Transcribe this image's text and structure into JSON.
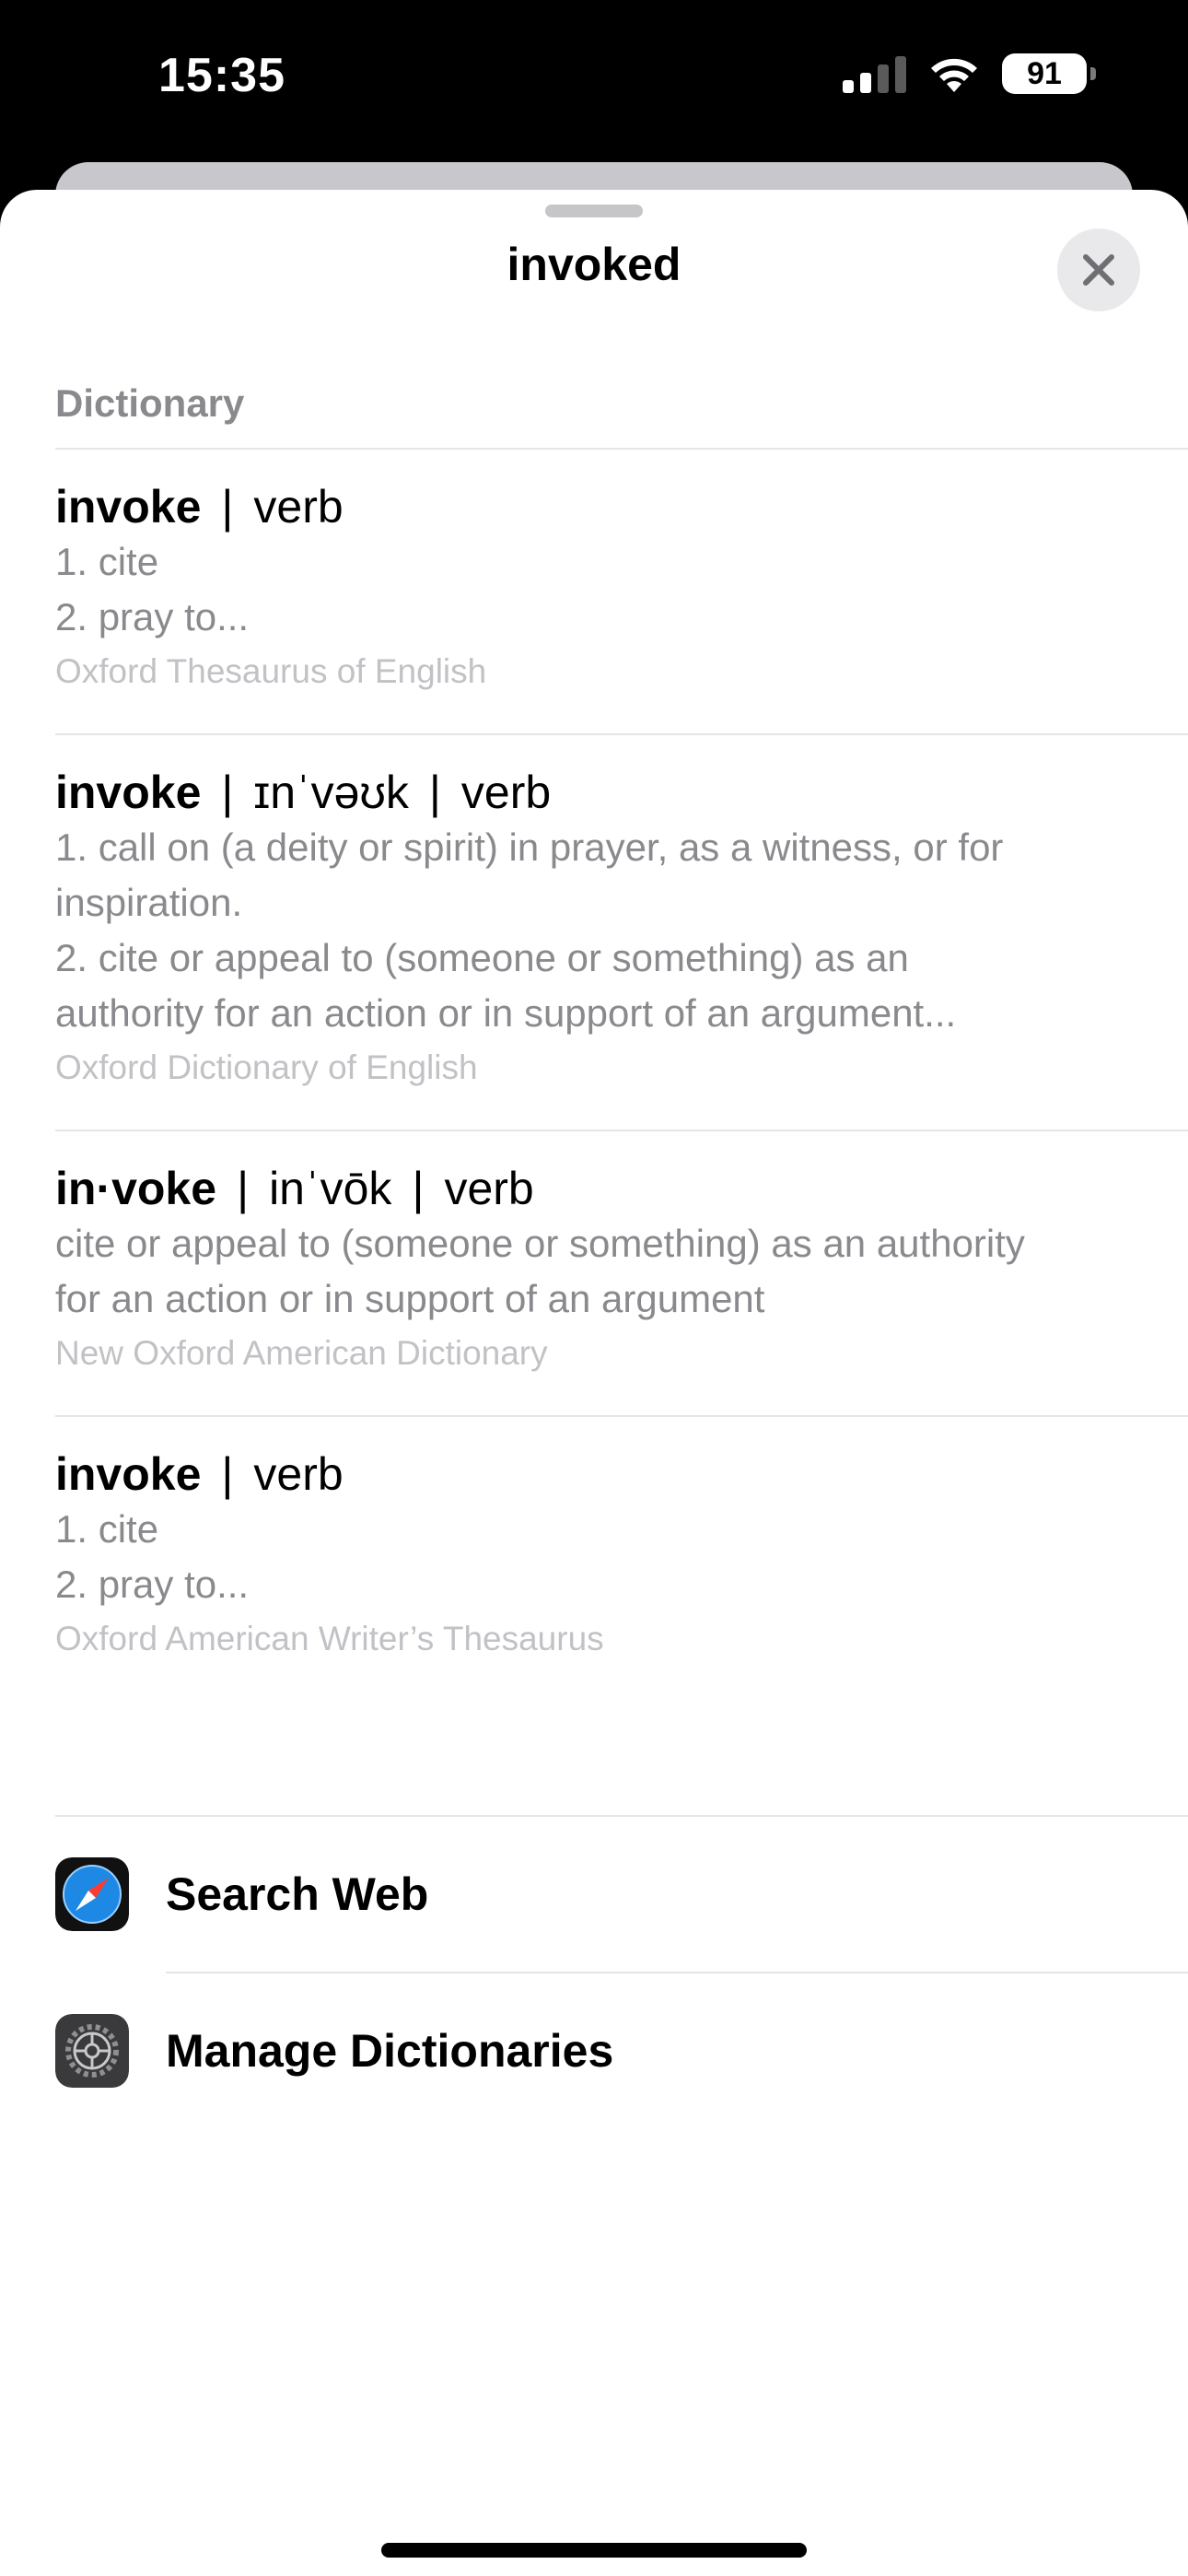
{
  "status_bar": {
    "time": "15:35",
    "battery": "91"
  },
  "sheet": {
    "title": "invoked"
  },
  "dictionary": {
    "section_title": "Dictionary",
    "entries": [
      {
        "headword": "invoke",
        "pronunciation": "",
        "pos": "verb",
        "lines": [
          "1. cite",
          "2. pray to..."
        ],
        "source": "Oxford Thesaurus of English"
      },
      {
        "headword": "invoke",
        "pronunciation": "ɪnˈvəʊk",
        "pos": "verb",
        "lines": [
          "1. call on (a deity or spirit) in prayer, as a witness, or for",
          "inspiration.",
          "2. cite or appeal to (someone or something) as an",
          "authority for an action or in support of an argument..."
        ],
        "source": "Oxford Dictionary of English"
      },
      {
        "headword": "in·voke",
        "pronunciation": "inˈvōk",
        "pos": "verb",
        "lines": [
          "cite or appeal to (someone or something) as an authority",
          "for an action or in support of an argument"
        ],
        "source": "New Oxford American Dictionary"
      },
      {
        "headword": "invoke",
        "pronunciation": "",
        "pos": "verb",
        "lines": [
          "1. cite",
          "2. pray to..."
        ],
        "source": "Oxford American Writer’s Thesaurus"
      }
    ]
  },
  "actions": {
    "search_web": "Search Web",
    "manage_dictionaries": "Manage Dictionaries"
  },
  "icons": {
    "safari": "compass-icon",
    "settings": "gear-icon",
    "close": "close-icon"
  },
  "colors": {
    "safari_blue": "#1e88e5",
    "settings_gray": "#3a3a3c"
  }
}
